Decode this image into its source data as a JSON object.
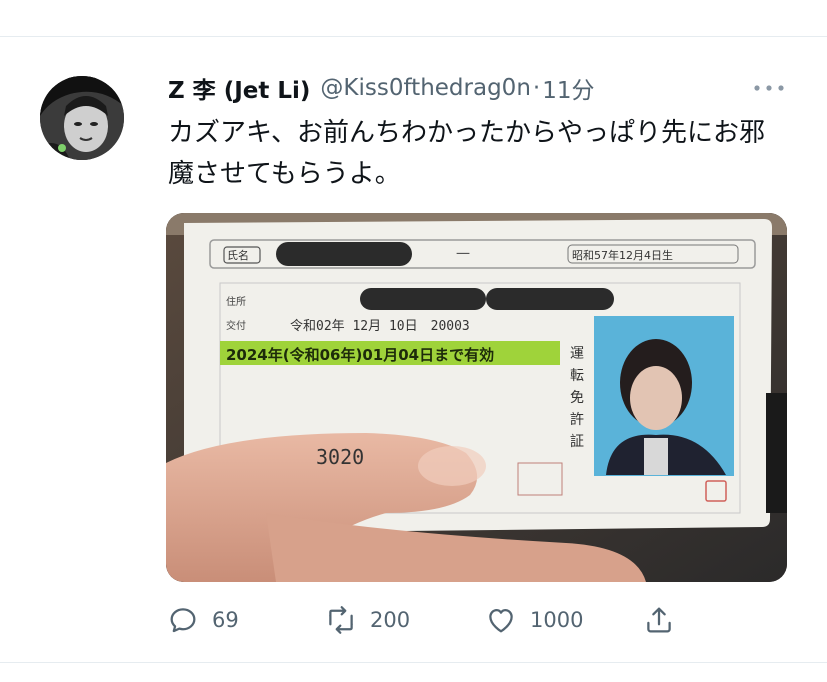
{
  "tweet": {
    "display_name": "Z 李 (Jet Li)",
    "handle": "@Kiss0fthedrag0n",
    "separator": "·",
    "time": "11分",
    "text": "カズアキ、お前んちわかったからやっぱり先にお邪魔させてもらうよ。",
    "more_icon": "more-horizontal-icon"
  },
  "media": {
    "license": {
      "type_label": "氏名",
      "dash": "一",
      "birth": "昭和57年12月4日生",
      "address_label": "住所",
      "issue_label": "交付",
      "issue_value": "令和02年 12月 10日　20003",
      "expiry": "2024年(令和06年)01月04日まで有効",
      "number_partial": "3020",
      "side_text": "運転免許証"
    }
  },
  "actions": {
    "reply": {
      "icon": "reply-icon",
      "count": "69"
    },
    "retweet": {
      "icon": "retweet-icon",
      "count": "200"
    },
    "like": {
      "icon": "heart-icon",
      "count": "1000"
    },
    "share": {
      "icon": "share-icon"
    }
  },
  "colors": {
    "text_primary": "#0f1419",
    "text_secondary": "#536471",
    "divider": "#e6ecf0",
    "expiry_highlight": "#9fd33a",
    "photo_bg": "#5ab3d9"
  }
}
